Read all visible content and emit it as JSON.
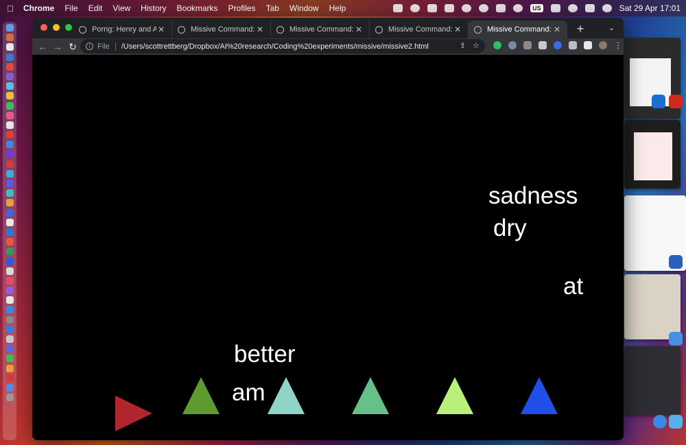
{
  "menubar": {
    "items": [
      "Chrome",
      "File",
      "Edit",
      "View",
      "History",
      "Bookmarks",
      "Profiles",
      "Tab",
      "Window",
      "Help"
    ],
    "keyboard_layout": "US",
    "clock": "Sat 29 Apr  17:01"
  },
  "browser": {
    "tabs": [
      {
        "title": "Porng: Henry and Anaïs"
      },
      {
        "title": "Missive Command: Nelson"
      },
      {
        "title": "Missive Command: Nelson"
      },
      {
        "title": "Missive Command: Nelson"
      },
      {
        "title": "Missive Command: Nelson"
      }
    ],
    "active_tab_index": 4,
    "omnibox": {
      "scheme_label": "File",
      "url": "/Users/scottrettberg/Dropbox/AI%20research/Coding%20experiments/missive/missive2.html"
    }
  },
  "game": {
    "background": "#000000",
    "words": [
      "sadness",
      "dry",
      "at",
      "better",
      "am"
    ],
    "player_ship": {
      "color": "#b0262f",
      "direction": "right"
    },
    "triangles": [
      {
        "color": "#5e9a2e"
      },
      {
        "color": "#8fd4c8"
      },
      {
        "color": "#66c08a"
      },
      {
        "color": "#b8f07a"
      },
      {
        "color": "#1f4fe8"
      }
    ]
  }
}
